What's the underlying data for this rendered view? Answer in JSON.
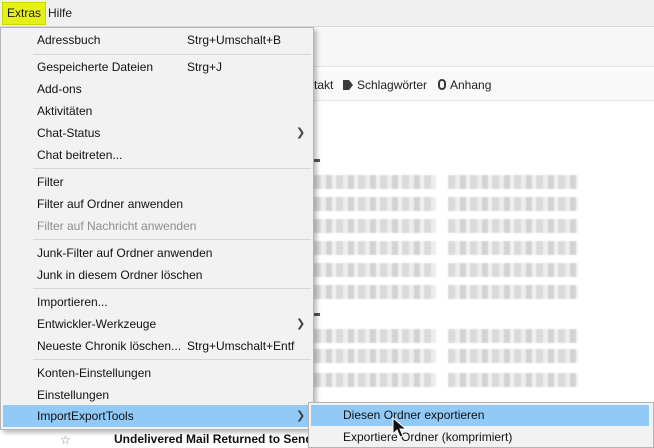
{
  "menubar": {
    "extras": "Extras",
    "hilfe": "Hilfe"
  },
  "filterbar": {
    "kontakt": "takt",
    "schlagwoerter": "Schlagwörter",
    "anhang": "Anhang"
  },
  "bottom": {
    "subject": "Undelivered Mail Returned to Send"
  },
  "menu": {
    "adressbuch": {
      "label": "Adressbuch",
      "shortcut": "Strg+Umschalt+B"
    },
    "dateien": {
      "label": "Gespeicherte Dateien",
      "shortcut": "Strg+J"
    },
    "addons": {
      "label": "Add-ons"
    },
    "aktivitaeten": {
      "label": "Aktivitäten"
    },
    "chatstatus": {
      "label": "Chat-Status"
    },
    "chatbeitreten": {
      "label": "Chat beitreten..."
    },
    "filter": {
      "label": "Filter"
    },
    "filterordner": {
      "label": "Filter auf Ordner anwenden"
    },
    "filternachricht": {
      "label": "Filter auf Nachricht anwenden"
    },
    "junkordner": {
      "label": "Junk-Filter auf Ordner anwenden"
    },
    "junkloeschen": {
      "label": "Junk in diesem Ordner löschen"
    },
    "importieren": {
      "label": "Importieren..."
    },
    "entwickler": {
      "label": "Entwickler-Werkzeuge"
    },
    "chronik": {
      "label": "Neueste Chronik löschen...",
      "shortcut": "Strg+Umschalt+Entf"
    },
    "konten": {
      "label": "Konten-Einstellungen"
    },
    "einstellungen": {
      "label": "Einstellungen"
    },
    "importexport": {
      "label": "ImportExportTools"
    }
  },
  "submenu": {
    "exportieren": "Diesen Ordner exportieren",
    "komprimiert": "Exportiere Ordner (komprimiert)"
  },
  "colors": {
    "highlight": "#91c9f7",
    "active_menu": "#e5f01a"
  }
}
